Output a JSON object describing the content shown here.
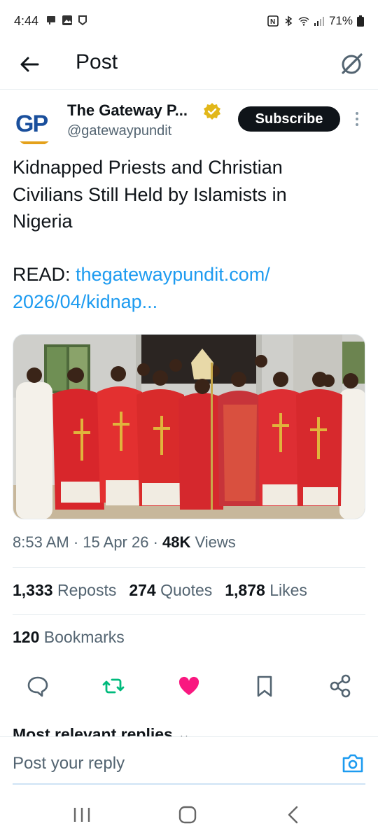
{
  "status_bar": {
    "time": "4:44",
    "battery": "71%"
  },
  "header": {
    "title": "Post"
  },
  "author": {
    "name": "The Gateway P...",
    "handle": "@gatewaypundit",
    "avatar_text": "GP",
    "subscribe_label": "Subscribe"
  },
  "post": {
    "text_line1": "Kidnapped Priests and Christian",
    "text_line2": "Civilians Still Held by Islamists in",
    "text_line3": "Nigeria",
    "read_label": "READ: ",
    "link_line1": "thegatewaypundit.com/",
    "link_line2": "2026/04/kidnap..."
  },
  "meta": {
    "time": "8:53 AM",
    "date": "15 Apr 26",
    "views_count": "48K",
    "views_label": "Views"
  },
  "stats": {
    "reposts_count": "1,333",
    "reposts_label": "Reposts",
    "quotes_count": "274",
    "quotes_label": "Quotes",
    "likes_count": "1,878",
    "likes_label": "Likes",
    "bookmarks_count": "120",
    "bookmarks_label": "Bookmarks"
  },
  "replies": {
    "section_label": "Most relevant replies",
    "reply_placeholder": "Post your reply"
  },
  "colors": {
    "accent": "#1d9bf0",
    "like": "#f91880",
    "repost": "#00ba7c",
    "verified": "#e2b719"
  },
  "icons": [
    "back-arrow-icon",
    "grok-icon",
    "verified-icon",
    "more-icon",
    "reply-icon",
    "repost-icon",
    "like-icon",
    "bookmark-icon",
    "share-icon",
    "camera-icon"
  ]
}
